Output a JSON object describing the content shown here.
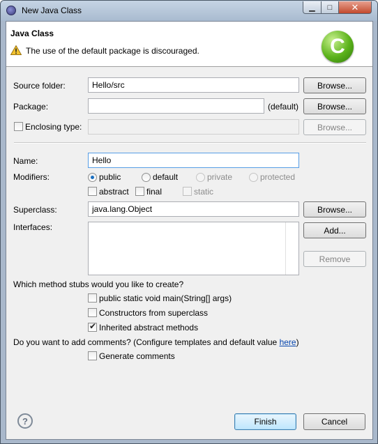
{
  "window": {
    "title": "New Java Class",
    "minimize": "▁",
    "maximize": "□",
    "close": "✕"
  },
  "header": {
    "title": "Java Class",
    "message": "The use of the default package is discouraged.",
    "logo_letter": "C"
  },
  "source_folder": {
    "label": "Source folder:",
    "value": "Hello/src",
    "browse": "Browse..."
  },
  "package": {
    "label": "Package:",
    "value": "",
    "suffix": "(default)",
    "browse": "Browse..."
  },
  "enclosing": {
    "label": "Enclosing type:",
    "value": "",
    "browse": "Browse...",
    "checked": false
  },
  "name": {
    "label": "Name:",
    "value": "Hello"
  },
  "modifiers": {
    "label": "Modifiers:",
    "public": "public",
    "default": "default",
    "private": "private",
    "protected": "protected",
    "abstract": "abstract",
    "final": "final",
    "static": "static",
    "selected": "public"
  },
  "superclass": {
    "label": "Superclass:",
    "value": "java.lang.Object",
    "browse": "Browse..."
  },
  "interfaces": {
    "label": "Interfaces:",
    "add": "Add...",
    "remove": "Remove"
  },
  "stubs": {
    "question": "Which method stubs would you like to create?",
    "main": "public static void main(String[] args)",
    "constructors": "Constructors from superclass",
    "inherited": "Inherited abstract methods",
    "main_checked": false,
    "constructors_checked": false,
    "inherited_checked": true
  },
  "comments": {
    "question": "Do you want to add comments? (Configure templates and default value ",
    "link": "here",
    "close_paren": ")",
    "generate": "Generate comments",
    "generate_checked": false
  },
  "footer": {
    "help": "?",
    "finish": "Finish",
    "cancel": "Cancel"
  },
  "colors": {
    "accent": "#3c7fb1",
    "logo": "#5bb21a",
    "warning": "#f2c230"
  },
  "icons": {
    "window": "eclipse-icon",
    "warning": "warning-icon",
    "logo": "class-wizard-icon",
    "help": "help-icon"
  }
}
